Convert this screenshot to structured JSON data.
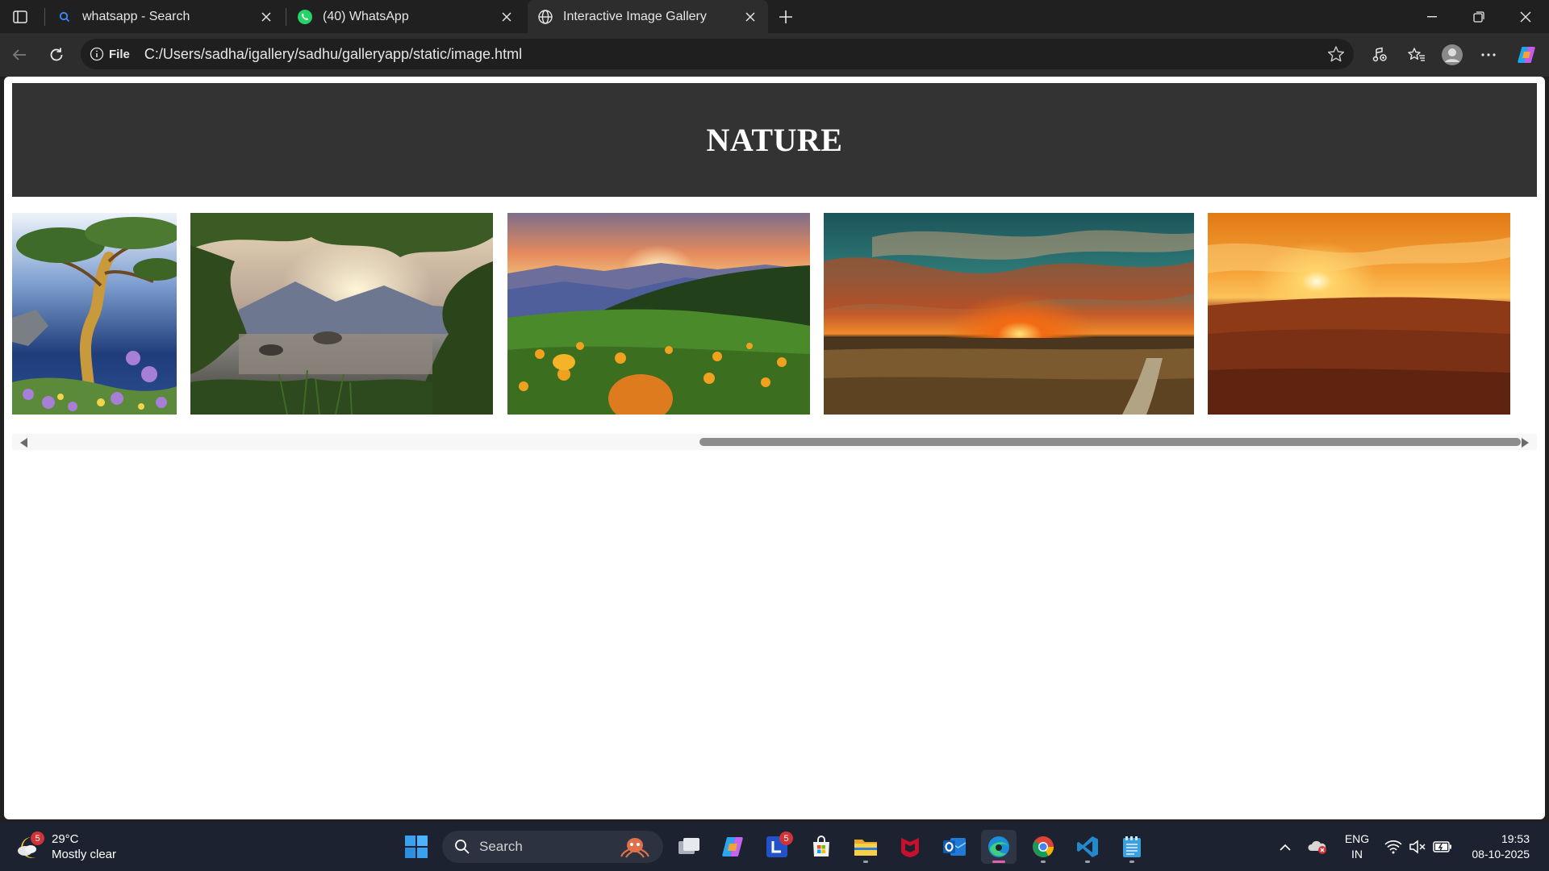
{
  "browser": {
    "tabs": [
      {
        "title": "whatsapp - Search",
        "icon": "search-icon",
        "active": false
      },
      {
        "title": "(40) WhatsApp",
        "icon": "whatsapp-icon",
        "active": false
      },
      {
        "title": "Interactive Image Gallery",
        "icon": "globe-icon",
        "active": true
      }
    ],
    "address": {
      "scheme_label": "File",
      "url": "C:/Users/sadha/igallery/sadhu/galleryapp/static/image.html"
    }
  },
  "page": {
    "title": "NATURE",
    "images": [
      {
        "name": "tree-over-lake-photo",
        "colors": [
          "#6f92c8",
          "#1e3f78",
          "#a77fd6"
        ]
      },
      {
        "name": "forest-lake-photo",
        "colors": [
          "#c9b59a",
          "#5b6f5a",
          "#2c3a22"
        ]
      },
      {
        "name": "mountain-flower-meadow-photo",
        "colors": [
          "#e58a5c",
          "#4f5f9c",
          "#3d6b22"
        ]
      },
      {
        "name": "field-sunset-photo",
        "colors": [
          "#2c6f73",
          "#d2511a",
          "#3c2a16"
        ]
      },
      {
        "name": "golden-sunset-field-photo",
        "colors": [
          "#f6b04a",
          "#e7660f",
          "#6c2b12"
        ]
      }
    ],
    "scrollbar": {
      "position_fraction": 0.45
    }
  },
  "taskbar": {
    "weather": {
      "temperature": "29°C",
      "condition": "Mostly clear",
      "badge": "5"
    },
    "search_label": "Search",
    "apps": [
      {
        "name": "task-view-icon"
      },
      {
        "name": "copilot-icon"
      },
      {
        "name": "lens-app-icon",
        "badge": "5"
      },
      {
        "name": "microsoft-store-icon"
      },
      {
        "name": "file-explorer-icon"
      },
      {
        "name": "mcafee-icon"
      },
      {
        "name": "outlook-icon"
      },
      {
        "name": "edge-icon",
        "active": true
      },
      {
        "name": "chrome-icon"
      },
      {
        "name": "vscode-icon"
      },
      {
        "name": "notepad-icon"
      }
    ],
    "language": {
      "line1": "ENG",
      "line2": "IN"
    },
    "clock": {
      "time": "19:53",
      "date": "08-10-2025"
    }
  }
}
